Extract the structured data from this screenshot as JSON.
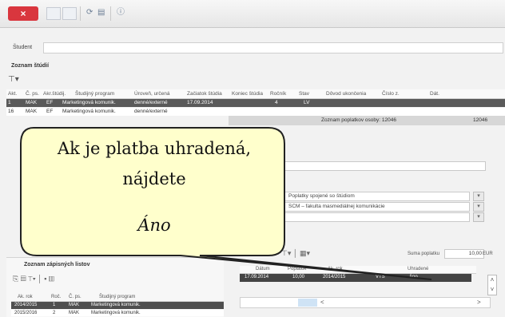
{
  "toolbar": {
    "close_glyph": "×"
  },
  "student": {
    "label": "Študent"
  },
  "sections": {
    "studies": "Zoznam štúdií",
    "enrollments": "Zoznam zápisných listov"
  },
  "grid": {
    "columns": [
      "Akt.",
      "Č. ps.",
      "Akr.štúdij.",
      "Študijný program",
      "Úroveň, určená",
      "Začiatok štúdia",
      "Koniec štúdia",
      "Ročník",
      "Stav",
      "Dôvod ukončenia",
      "Číslo z.",
      "Dát."
    ],
    "rows": [
      [
        "1",
        "MAK",
        "EF",
        "Marketingová komunik.",
        "denné/externé",
        "17.09.2014",
        "",
        "4",
        "LV",
        "",
        "",
        ""
      ],
      [
        "16",
        "MAK",
        "EF",
        "Marketingová komunik.",
        "denné/externé",
        "",
        "",
        "",
        "",
        "",
        "",
        ""
      ]
    ]
  },
  "payments": {
    "bar_title": "Zoznam poplatkov osoby: 12046",
    "bar_right": "12046"
  },
  "form": {
    "field1": "Poplatky spojené so štúdiom",
    "field2": "SCM – fakulta masmediálnej komunikácie"
  },
  "sum": {
    "label": "Suma poplatku",
    "value": "10,00",
    "currency": "EUR"
  },
  "pay_table": {
    "columns": [
      "Dátum",
      "Poplatok",
      "Ak. rok",
      "",
      "Uhradené"
    ],
    "row": [
      "17.09.2014",
      "10,00",
      "2014/2015",
      "VTS",
      "Áno"
    ]
  },
  "enroll_table": {
    "columns": [
      "Ak. rok",
      "Roč.",
      "Č. ps.",
      "Študijný program"
    ],
    "rows": [
      [
        "2014/2015",
        "1",
        "MAK",
        "Marketingová komunik."
      ],
      [
        "2015/2016",
        "2",
        "MAK",
        "Marketingová komunik."
      ]
    ]
  },
  "pager": {
    "nav_back": "<",
    "nav_fwd": ">"
  },
  "callout": {
    "line1": "Ak je platba uhradená,",
    "line2": "nájdete",
    "line3": "Áno"
  },
  "colors": {
    "close": "#d9363e",
    "highlight_row": "#5a5a5a",
    "callout_fill": "#ffffcc",
    "callout_border": "#222222"
  }
}
